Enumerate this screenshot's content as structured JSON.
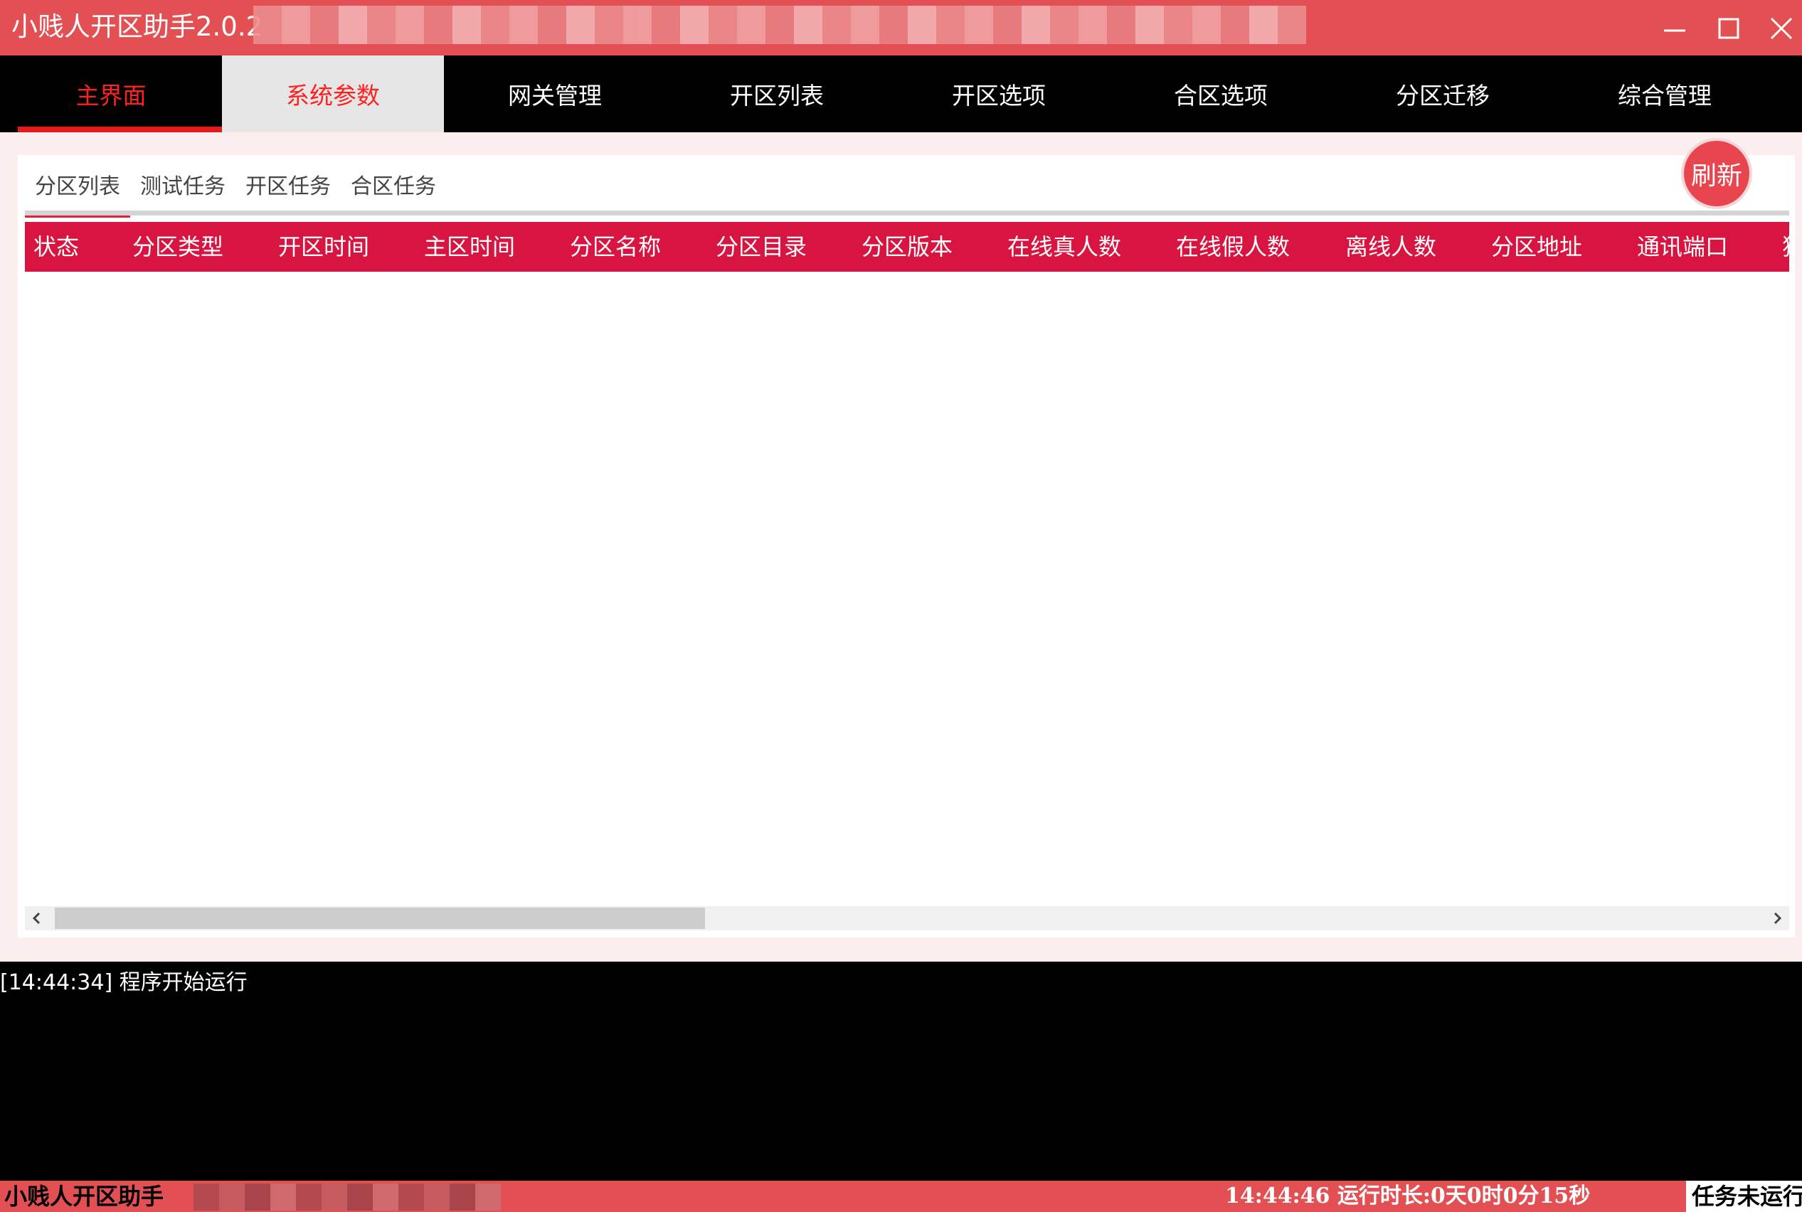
{
  "window": {
    "title": "小贱人开区助手2.0.2"
  },
  "nav": {
    "tabs": [
      {
        "label": "主界面"
      },
      {
        "label": "系统参数"
      },
      {
        "label": "网关管理"
      },
      {
        "label": "开区列表"
      },
      {
        "label": "开区选项"
      },
      {
        "label": "合区选项"
      },
      {
        "label": "分区迁移"
      },
      {
        "label": "综合管理"
      }
    ]
  },
  "subtabs": [
    {
      "label": "分区列表"
    },
    {
      "label": "测试任务"
    },
    {
      "label": "开区任务"
    },
    {
      "label": "合区任务"
    }
  ],
  "refresh_label": "刷新",
  "table": {
    "columns": [
      "状态",
      "分区类型",
      "开区时间",
      "主区时间",
      "分区名称",
      "分区目录",
      "分区版本",
      "在线真人数",
      "在线假人数",
      "离线人数",
      "分区地址",
      "通讯端口",
      "独"
    ],
    "rows": []
  },
  "log": {
    "lines": [
      "[14:44:34] 程序开始运行"
    ]
  },
  "status": {
    "app_name": "小贱人开区助手",
    "time_text": "14:44:46 运行时长:0天0时0分15秒",
    "task_text": "任务未运行"
  },
  "colors": {
    "titlebar": "#e35053",
    "nav_bg": "#000000",
    "header_bg": "#d81440",
    "accent": "#e31b1b"
  }
}
